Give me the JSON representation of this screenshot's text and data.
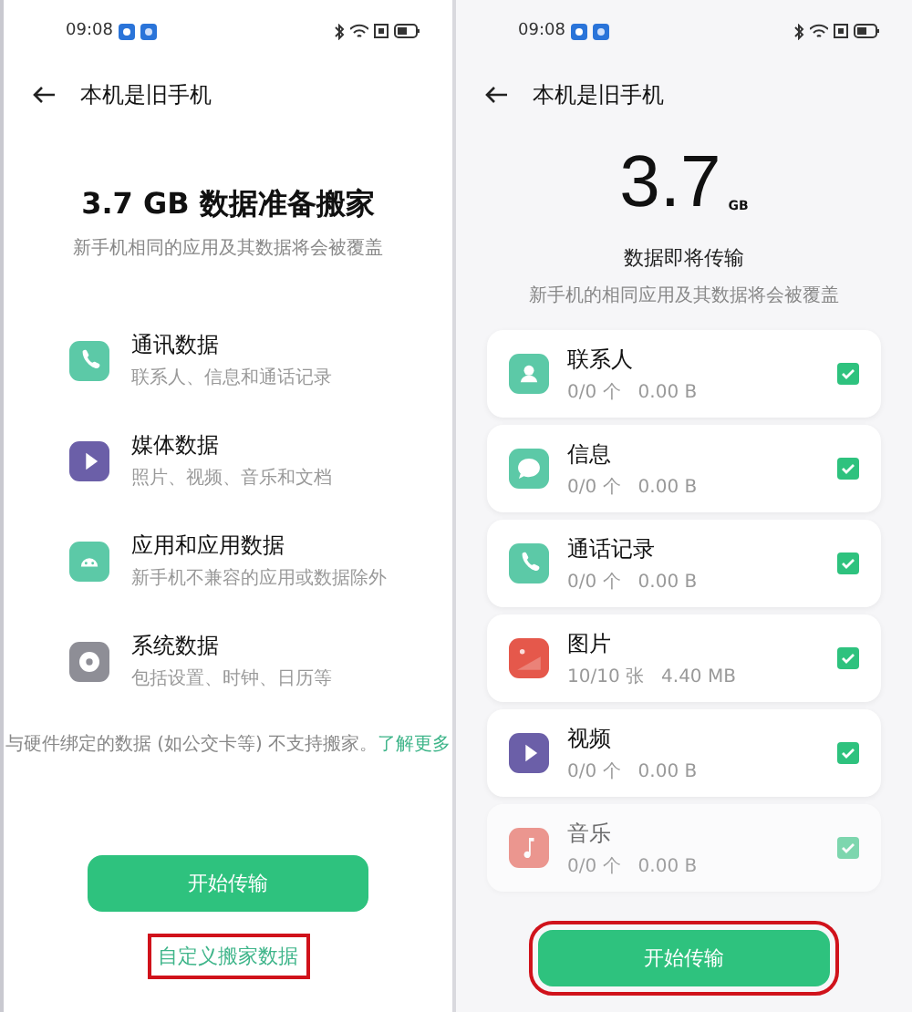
{
  "screens": [
    {
      "status_bar": {
        "time": "09:08"
      },
      "header": {
        "title": "本机是旧手机"
      },
      "kind": "overview",
      "size_title": "3.7 GB 数据准备搬家",
      "subtitle": "新手机相同的应用及其数据将会被覆盖",
      "categories": [
        {
          "kind": "phone",
          "title": "通讯数据",
          "detail": "联系人、信息和通话记录"
        },
        {
          "kind": "play",
          "title": "媒体数据",
          "detail": "照片、视频、音乐和文档"
        },
        {
          "kind": "android",
          "title": "应用和应用数据",
          "detail": "新手机不兼容的应用或数据除外"
        },
        {
          "kind": "disc",
          "title": "系统数据",
          "detail": "包括设置、时钟、日历等"
        }
      ],
      "note": "与硬件绑定的数据 (如公交卡等) 不支持搬家。",
      "note_link": "了解更多",
      "primary_button": {
        "label": "开始传输",
        "highlighted": false
      },
      "secondary_link": {
        "label": "自定义搬家数据",
        "highlighted": true
      }
    },
    {
      "status_bar": {
        "time": "09:08"
      },
      "header": {
        "title": "本机是旧手机"
      },
      "kind": "detail",
      "size_value": "3.7",
      "size_unit": "GB",
      "subtitle": "数据即将传输",
      "detail_note": "新手机的相同应用及其数据将会被覆盖",
      "items": [
        {
          "kind": "person",
          "title": "联系人",
          "detail": "0/0 个   0.00 B",
          "checked": true,
          "faded": false
        },
        {
          "kind": "chat",
          "title": "信息",
          "detail": "0/0 个   0.00 B",
          "checked": true,
          "faded": false
        },
        {
          "kind": "phone",
          "title": "通话记录",
          "detail": "0/0 个   0.00 B",
          "checked": true,
          "faded": false
        },
        {
          "kind": "image",
          "title": "图片",
          "detail": "10/10 张   4.40 MB",
          "checked": true,
          "faded": false
        },
        {
          "kind": "play",
          "title": "视频",
          "detail": "0/0 个   0.00 B",
          "checked": true,
          "faded": false
        },
        {
          "kind": "music",
          "title": "音乐",
          "detail": "0/0 个   0.00 B",
          "checked": true,
          "faded": true
        }
      ],
      "primary_button": {
        "label": "开始传输",
        "highlighted": true
      }
    }
  ]
}
